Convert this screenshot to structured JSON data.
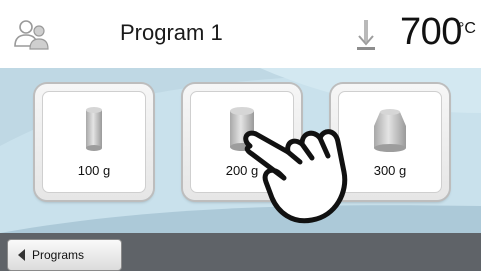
{
  "header": {
    "title": "Program 1",
    "temperature_value": "700",
    "temperature_unit": "°C",
    "user_icon": "users-icon",
    "temperature_icon": "temperature-probe-icon"
  },
  "tiles": [
    {
      "label": "100 g",
      "icon": "small-cylinder-icon"
    },
    {
      "label": "200 g",
      "icon": "medium-cylinder-icon"
    },
    {
      "label": "300 g",
      "icon": "large-cylinder-icon"
    }
  ],
  "footer": {
    "back_label": "Programs",
    "back_icon": "arrow-left-icon"
  },
  "overlay": {
    "icon": "pointing-hand-icon"
  },
  "colors": {
    "panel_background": "#bfd8e4",
    "footer_background": "#5f6368"
  }
}
